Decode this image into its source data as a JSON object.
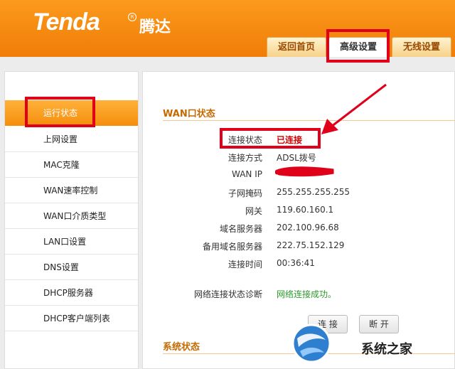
{
  "brand": {
    "logo": "Tenda",
    "registered": "R",
    "name_cn": "腾达"
  },
  "tabs": [
    {
      "label": "返回首页",
      "active": false
    },
    {
      "label": "高级设置",
      "active": true
    },
    {
      "label": "无线设置",
      "active": false
    }
  ],
  "sidebar": {
    "items": [
      {
        "label": "运行状态",
        "active": true
      },
      {
        "label": "上网设置"
      },
      {
        "label": "MAC克隆"
      },
      {
        "label": "WAN速率控制"
      },
      {
        "label": "WAN口介质类型"
      },
      {
        "label": "LAN口设置"
      },
      {
        "label": "DNS设置"
      },
      {
        "label": "DHCP服务器"
      },
      {
        "label": "DHCP客户端列表"
      }
    ]
  },
  "wan": {
    "title": "WAN口状态",
    "rows": [
      {
        "label": "连接状态",
        "value": "已连接"
      },
      {
        "label": "连接方式",
        "value": "ADSL拨号"
      },
      {
        "label": "WAN IP",
        "value": ""
      },
      {
        "label": "子网掩码",
        "value": "255.255.255.255"
      },
      {
        "label": "网关",
        "value": "119.60.160.1"
      },
      {
        "label": "域名服务器",
        "value": "202.100.96.68"
      },
      {
        "label": "备用域名服务器",
        "value": "222.75.152.129"
      },
      {
        "label": "连接时间",
        "value": "00:36:41"
      }
    ],
    "diag": {
      "label": "网络连接状态诊断",
      "value": "网络连接成功。"
    },
    "buttons": {
      "connect": "连 接",
      "disconnect": "断 开"
    }
  },
  "system": {
    "title": "系统状态"
  },
  "watermark": {
    "text": "系统之家"
  },
  "colors": {
    "header": "#f58a10",
    "highlight": "#e0001a",
    "status_connected": "#d40000",
    "diag_ok": "#2c9a2c"
  }
}
